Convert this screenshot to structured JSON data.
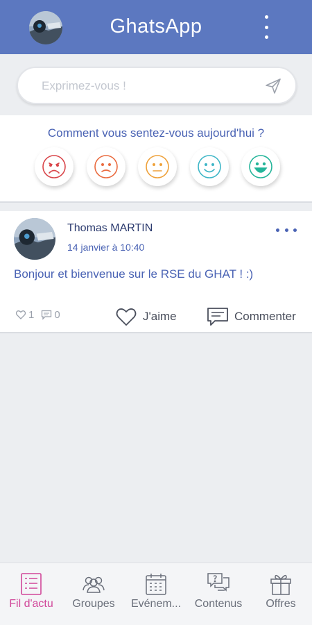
{
  "header": {
    "title": "GhatsApp",
    "color": "#5c78c0"
  },
  "composer": {
    "placeholder": "Exprimez-vous !"
  },
  "mood": {
    "question": "Comment vous sentez-vous aujourd'hui ?",
    "faces": [
      {
        "name": "very-sad",
        "color": "#d9464a"
      },
      {
        "name": "sad",
        "color": "#ea6b3f"
      },
      {
        "name": "neutral",
        "color": "#eea13a"
      },
      {
        "name": "happy",
        "color": "#3eb6c7"
      },
      {
        "name": "very-happy",
        "color": "#24b59a"
      }
    ]
  },
  "post": {
    "author": "Thomas MARTIN",
    "date": "14 janvier à 10:40",
    "text": "Bonjour et bienvenue sur le RSE du GHAT ! :)",
    "likes_count": "1",
    "comments_count": "0",
    "like_label": "J'aime",
    "comment_label": "Commenter"
  },
  "nav": {
    "active_color": "#d1489a",
    "items": [
      {
        "label": "Fil d'actu",
        "icon": "newsfeed-icon",
        "active": true
      },
      {
        "label": "Groupes",
        "icon": "groups-icon",
        "active": false
      },
      {
        "label": "Evénem...",
        "icon": "calendar-icon",
        "active": false
      },
      {
        "label": "Contenus",
        "icon": "contents-icon",
        "active": false
      },
      {
        "label": "Offres",
        "icon": "gift-icon",
        "active": false
      }
    ]
  }
}
